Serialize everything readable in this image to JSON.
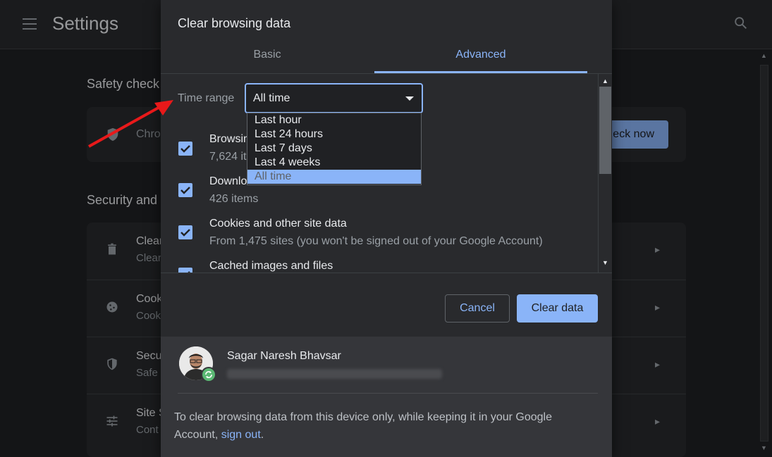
{
  "settings": {
    "title": "Settings",
    "safety_check_heading": "Safety check",
    "safety_row_text": "Chro",
    "check_now_label": "eck now",
    "security_heading": "Security and",
    "rows": [
      {
        "title": "Clear",
        "sub": "Clear"
      },
      {
        "title": "Cook",
        "sub": "Cook"
      },
      {
        "title": "Secu",
        "sub": "Safe"
      },
      {
        "title": "Site S",
        "sub": "Cont"
      }
    ]
  },
  "dialog": {
    "title": "Clear browsing data",
    "tabs": [
      {
        "label": "Basic",
        "active": false
      },
      {
        "label": "Advanced",
        "active": true
      }
    ],
    "time_range_label": "Time range",
    "time_range_value": "All time",
    "time_range_options": [
      "Last hour",
      "Last 24 hours",
      "Last 7 days",
      "Last 4 weeks",
      "All time"
    ],
    "items": [
      {
        "title": "Browsin",
        "sub": "7,624 it",
        "checked": true
      },
      {
        "title": "Downlo",
        "sub": "426 items",
        "checked": true
      },
      {
        "title": "Cookies and other site data",
        "sub": "From 1,475 sites (you won't be signed out of your Google Account)",
        "checked": true
      },
      {
        "title": "Cached images and files",
        "sub": "",
        "checked": true
      }
    ],
    "cancel_label": "Cancel",
    "clear_label": "Clear data",
    "user_name": "Sagar Naresh Bhavsar",
    "footer_text": "To clear browsing data from this device only, while keeping it in your Google Account,",
    "footer_link": "sign out",
    "footer_end": "."
  },
  "colors": {
    "accent": "#8ab4f8",
    "dialog_bg": "#292a2d",
    "annotation_arrow": "#e8191a"
  }
}
